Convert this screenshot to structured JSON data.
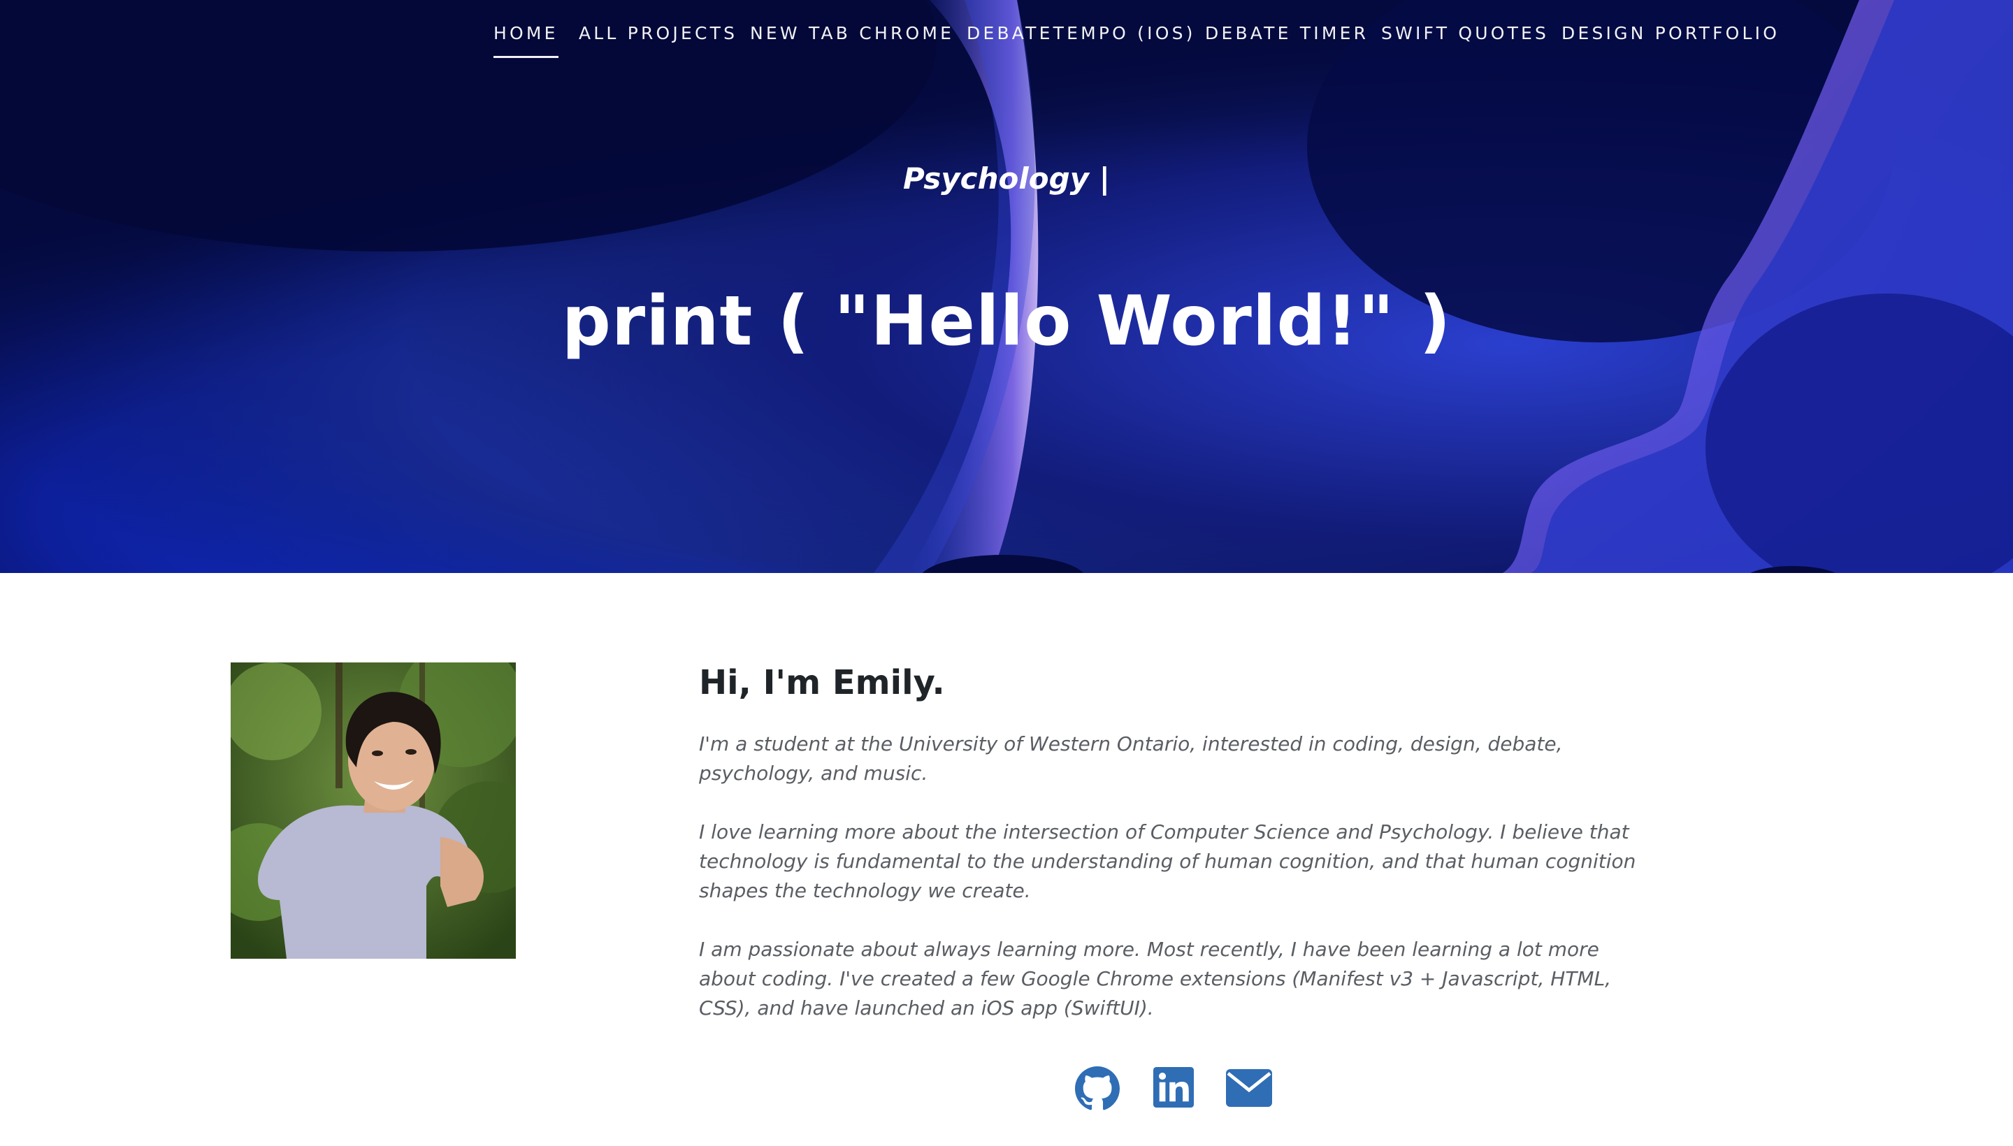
{
  "nav": {
    "items": [
      {
        "label": "HOME",
        "active": true
      },
      {
        "label": "ALL PROJECTS",
        "active": false
      },
      {
        "label": "NEW TAB CHROME",
        "active": false
      },
      {
        "label": "DEBATETEMPO (IOS)",
        "active": false
      },
      {
        "label": "DEBATE TIMER",
        "active": false
      },
      {
        "label": "SWIFT QUOTES",
        "active": false
      },
      {
        "label": "DESIGN PORTFOLIO",
        "active": false
      }
    ]
  },
  "hero": {
    "subtitle": "Psychology |",
    "title": "print ( \"Hello World!\" )"
  },
  "about": {
    "heading": "Hi, I'm Emily.",
    "paragraphs": [
      "I'm a student at the University of Western Ontario, interested in coding, design, debate, psychology, and music.",
      "I love learning more about the intersection of Computer Science and Psychology. I believe that technology is fundamental to the understanding of human cognition, and that human cognition shapes the technology we create.",
      "I am passionate about always learning more. Most recently, I have been learning a lot more about coding. I've created a few Google Chrome extensions (Manifest v3 + Javascript, HTML, CSS), and have launched an iOS app (SwiftUI)."
    ]
  },
  "social": {
    "icons": [
      "github-icon",
      "linkedin-icon",
      "email-icon"
    ]
  },
  "colors": {
    "accent": "#2f6db5",
    "hero_dark": "#020735",
    "hero_blue": "#1d3bd6",
    "hero_violet": "#7b5cf0"
  }
}
